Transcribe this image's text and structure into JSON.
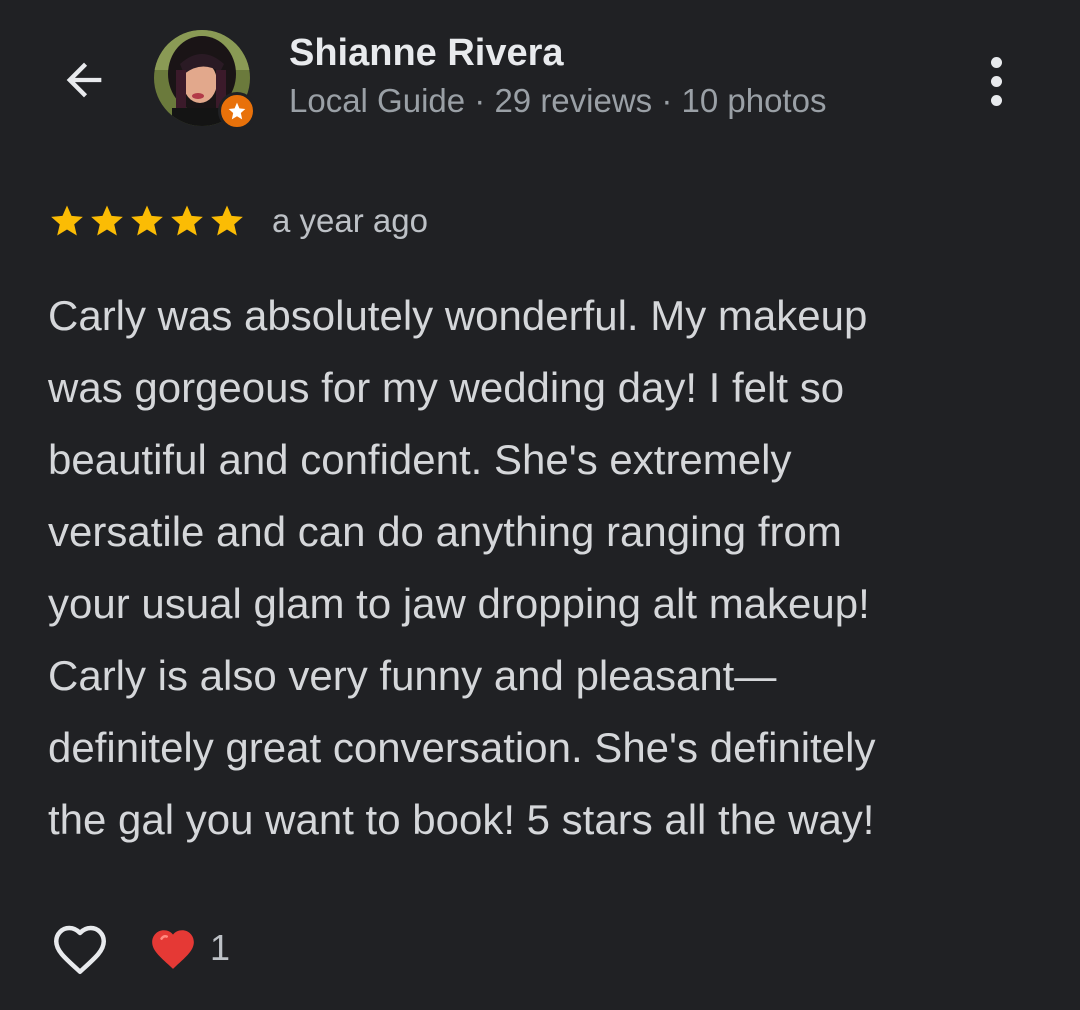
{
  "header": {
    "back_icon": "arrow-back-icon",
    "user_name": "Shianne Rivera",
    "user_meta": "Local Guide · 29 reviews · 10 photos",
    "more_icon": "more-vert-icon",
    "badge_icon": "local-guide-star-icon"
  },
  "review": {
    "rating": 5,
    "max_rating": 5,
    "time_ago": "a year ago",
    "lines": [
      "Carly was absolutely wonderful. My makeup",
      "was gorgeous for my wedding day! I felt so",
      "beautiful and confident. She's extremely",
      "versatile and can do anything ranging from",
      "your usual glam to jaw dropping alt makeup!",
      "Carly is also very funny and pleasant—",
      "definitely great conversation. She's definitely",
      "the gal you want to book! 5 stars all the way!"
    ]
  },
  "actions": {
    "like_icon": "heart-outline-icon",
    "reaction_icon": "red-heart-icon",
    "reaction_count": "1"
  },
  "colors": {
    "background": "#202124",
    "star": "#fbbc04",
    "badge": "#e8710a",
    "heart": "#e53935"
  }
}
